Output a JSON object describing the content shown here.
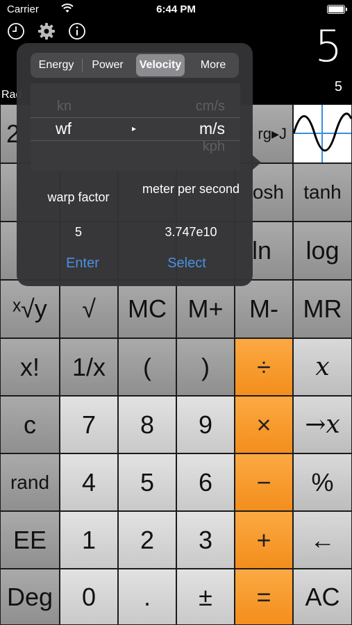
{
  "status": {
    "carrier": "Carrier",
    "time": "6:44 PM"
  },
  "display": {
    "main": "5",
    "memory": "5",
    "angle_mode": "Rad"
  },
  "popover": {
    "tabs": [
      "Energy",
      "Power",
      "Velocity",
      "More"
    ],
    "selected_tab": "Velocity",
    "picker": {
      "from_above": "kn",
      "from": "wf",
      "to_above": "cm/s",
      "to": "m/s",
      "to_below": "kph"
    },
    "from_name": "warp factor",
    "to_name": "meter per second",
    "from_value": "5",
    "to_value": "3.747e10",
    "enter_label": "Enter",
    "select_label": "Select"
  },
  "keys": {
    "row0": {
      "k0": "2",
      "k4": "rg▸J"
    },
    "row1": {
      "k4": "osh",
      "k5": "tanh"
    },
    "row2": {
      "k4": "ln",
      "k5": "log"
    },
    "row3": [
      "ˣ√y",
      "√",
      "MC",
      "M+",
      "M-",
      "MR"
    ],
    "row4": [
      "x!",
      "1/x",
      "(",
      ")",
      "÷",
      "𝑥"
    ],
    "row5": [
      "c",
      "7",
      "8",
      "9",
      "×",
      "→𝑥"
    ],
    "row6": [
      "rand",
      "4",
      "5",
      "6",
      "−",
      "%"
    ],
    "row7": [
      "EE",
      "1",
      "2",
      "3",
      "+",
      "←"
    ],
    "row8": [
      "Deg",
      "0",
      ".",
      "±",
      "=",
      "AC"
    ]
  }
}
